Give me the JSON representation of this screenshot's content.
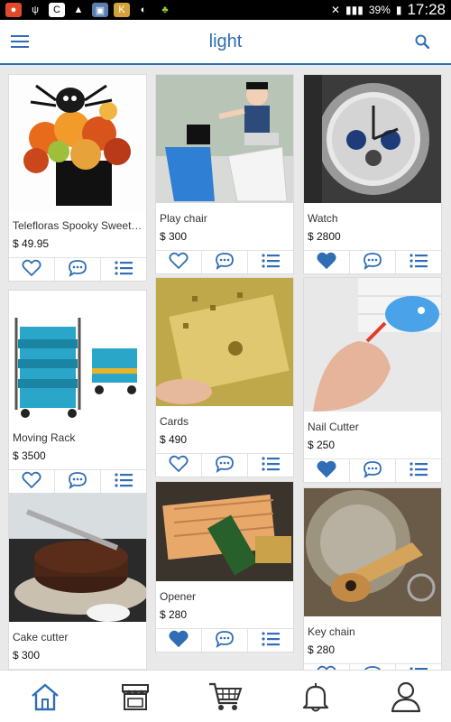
{
  "status_bar": {
    "battery": "39%",
    "time": "17:28"
  },
  "app_bar": {
    "title": "light"
  },
  "products": [
    {
      "name": "Telefloras Spooky Sweet Fl...",
      "price": "$ 49.95",
      "liked": false
    },
    {
      "name": "Play chair",
      "price": "$ 300",
      "liked": false
    },
    {
      "name": "Watch",
      "price": "$ 2800",
      "liked": true
    },
    {
      "name": "Moving Rack",
      "price": "$ 3500",
      "liked": false
    },
    {
      "name": "Cards",
      "price": "$ 490",
      "liked": false
    },
    {
      "name": "Nail Cutter",
      "price": "$ 250",
      "liked": true
    },
    {
      "name": "Cake cutter",
      "price": "$ 300",
      "liked": false
    },
    {
      "name": "Opener",
      "price": "$ 280",
      "liked": true
    },
    {
      "name": "Key chain",
      "price": "$ 280",
      "liked": false
    }
  ],
  "icons": {
    "menu": "menu-icon",
    "search": "search-icon",
    "like": "heart-icon",
    "comment": "comment-icon",
    "list": "list-icon",
    "nav": [
      "home-icon",
      "store-icon",
      "cart-icon",
      "bell-icon",
      "profile-icon"
    ]
  },
  "colors": {
    "accent": "#2f6db5",
    "liked": "#2f6db5"
  }
}
